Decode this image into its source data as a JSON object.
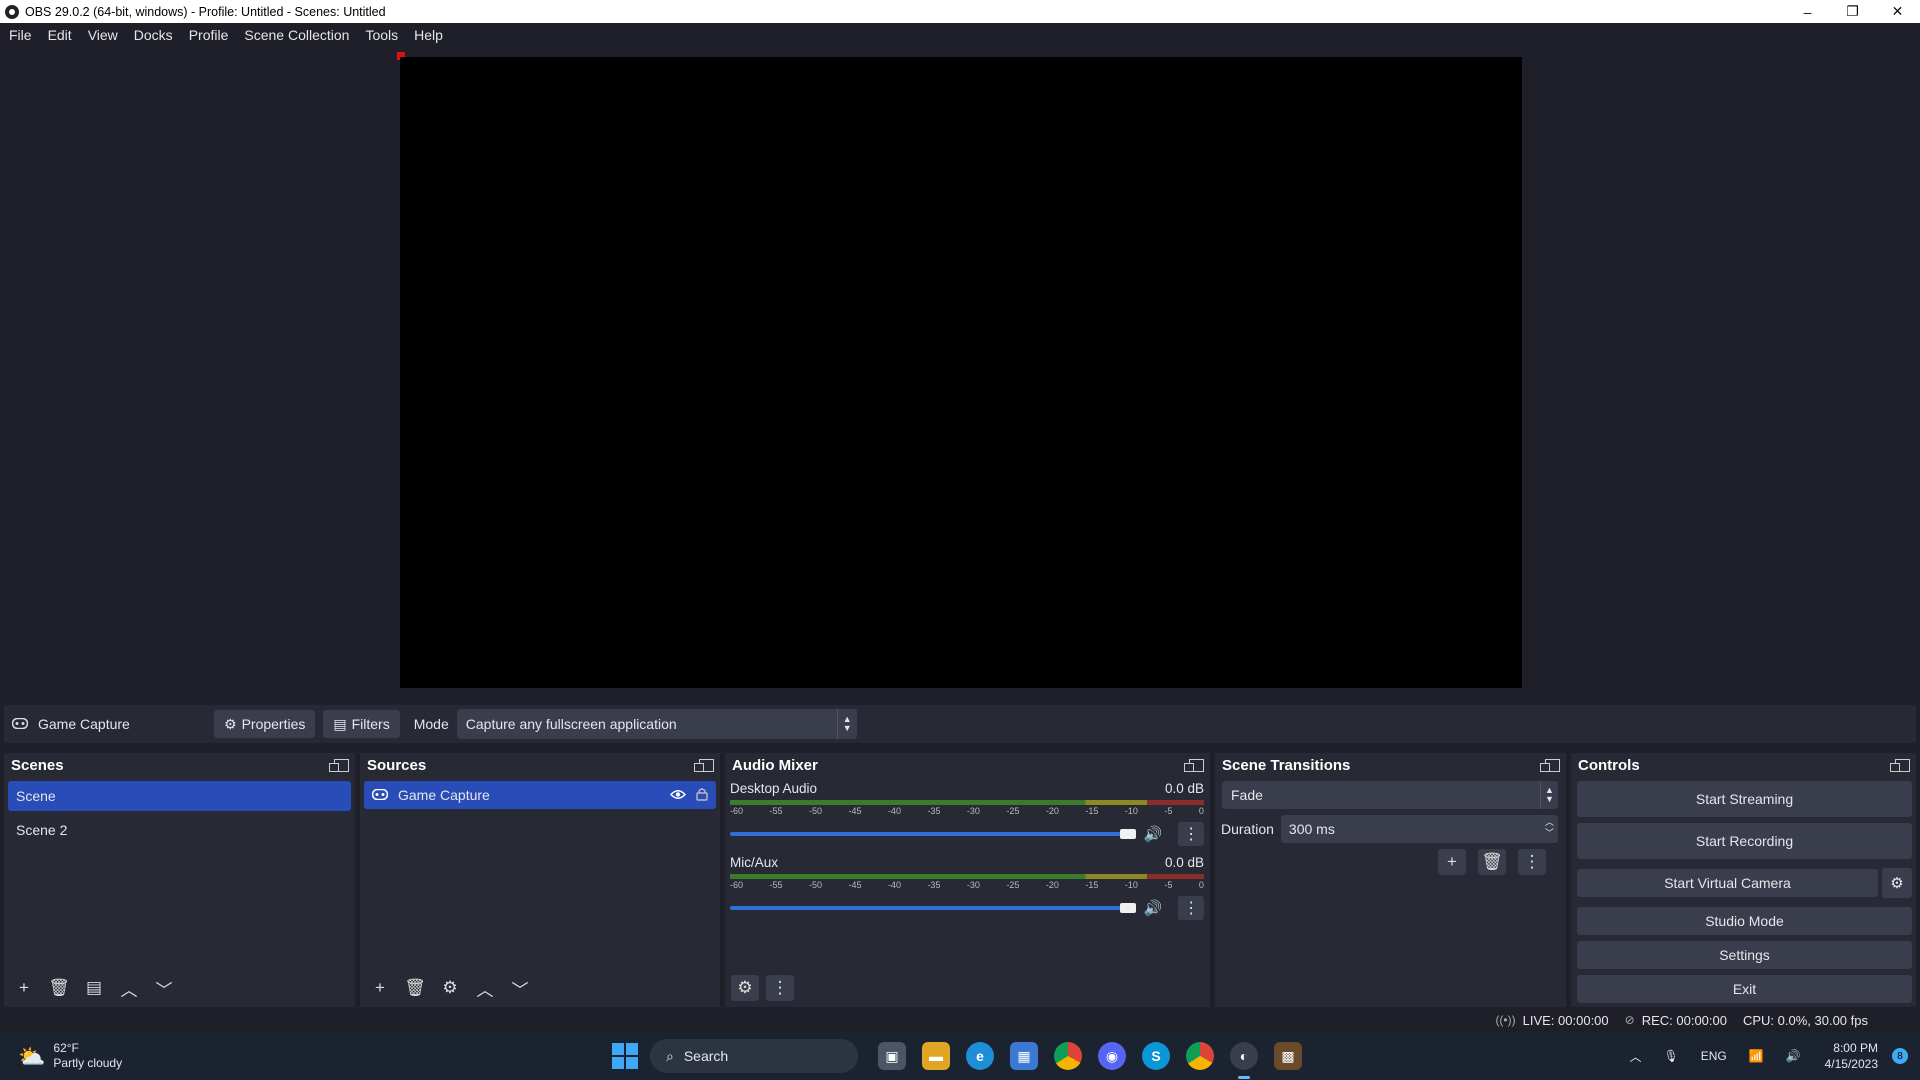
{
  "window": {
    "title": "OBS 29.0.2 (64-bit, windows) - Profile: Untitled - Scenes: Untitled",
    "minimize": "–",
    "restore": "❐",
    "close": "✕"
  },
  "menu": [
    "File",
    "Edit",
    "View",
    "Docks",
    "Profile",
    "Scene Collection",
    "Tools",
    "Help"
  ],
  "source_toolbar": {
    "source_name": "Game Capture",
    "properties_label": "Properties",
    "filters_label": "Filters",
    "mode_label": "Mode",
    "mode_value": "Capture any fullscreen application"
  },
  "scenes": {
    "title": "Scenes",
    "items": [
      "Scene",
      "Scene 2"
    ],
    "selected_index": 0
  },
  "sources": {
    "title": "Sources",
    "items": [
      "Game Capture"
    ]
  },
  "audio_mixer": {
    "title": "Audio Mixer",
    "scale": [
      "-60",
      "-55",
      "-50",
      "-45",
      "-40",
      "-35",
      "-30",
      "-25",
      "-20",
      "-15",
      "-10",
      "-5",
      "0"
    ],
    "channels": [
      {
        "name": "Desktop Audio",
        "level": "0.0 dB"
      },
      {
        "name": "Mic/Aux",
        "level": "0.0 dB"
      }
    ]
  },
  "scene_transitions": {
    "title": "Scene Transitions",
    "transition": "Fade",
    "duration_label": "Duration",
    "duration_value": "300 ms"
  },
  "controls": {
    "title": "Controls",
    "start_streaming": "Start Streaming",
    "start_recording": "Start Recording",
    "start_virtual_camera": "Start Virtual Camera",
    "studio_mode": "Studio Mode",
    "settings": "Settings",
    "exit": "Exit"
  },
  "status": {
    "live": "LIVE: 00:00:00",
    "rec": "REC: 00:00:00",
    "cpu": "CPU: 0.0%, 30.00 fps"
  },
  "taskbar": {
    "weather_temp": "62°F",
    "weather_desc": "Partly cloudy",
    "search_label": "Search",
    "lang": "ENG",
    "time": "8:00 PM",
    "date": "4/15/2023",
    "notification_count": "8"
  },
  "colors": {
    "selection": "#284cb8",
    "panel": "#272934",
    "background": "#1e1f29",
    "record_marker": "#e01010"
  }
}
